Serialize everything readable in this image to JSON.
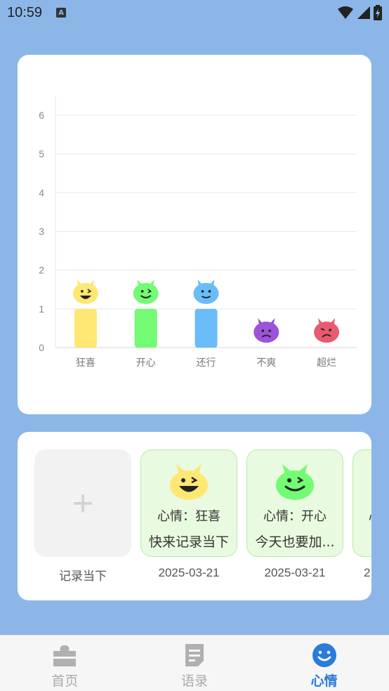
{
  "status_bar": {
    "time": "10:59",
    "notification_icon": "A"
  },
  "chart_data": {
    "type": "bar",
    "categories": [
      "狂喜",
      "开心",
      "还行",
      "不爽",
      "超烂"
    ],
    "values": [
      1,
      1,
      1,
      0,
      0
    ],
    "colors": [
      "#ffe774",
      "#73fb73",
      "#69bcf8",
      "#9b53d9",
      "#e85a6e"
    ],
    "ylim": [
      0,
      6
    ],
    "yticks": [
      "0",
      "1",
      "2",
      "3",
      "4",
      "5",
      "6"
    ],
    "title": "",
    "xlabel": "",
    "ylabel": "",
    "grid": true
  },
  "records": {
    "add": {
      "caption": "记录当下"
    },
    "items": [
      {
        "mood": "心情：狂喜",
        "text": "快来记录当下",
        "date": "2025-03-21",
        "face_color": "#ffe774"
      },
      {
        "mood": "心情：开心",
        "text": "今天也要加...",
        "date": "2025-03-21",
        "face_color": "#73fb73"
      },
      {
        "mood": "心",
        "text": "",
        "date": "2",
        "face_color": "#73fb73"
      }
    ]
  },
  "nav": [
    {
      "label": "首页",
      "icon": "puzzle-icon"
    },
    {
      "label": "语录",
      "icon": "document-icon"
    },
    {
      "label": "心情",
      "icon": "smiley-icon",
      "active": true
    }
  ]
}
